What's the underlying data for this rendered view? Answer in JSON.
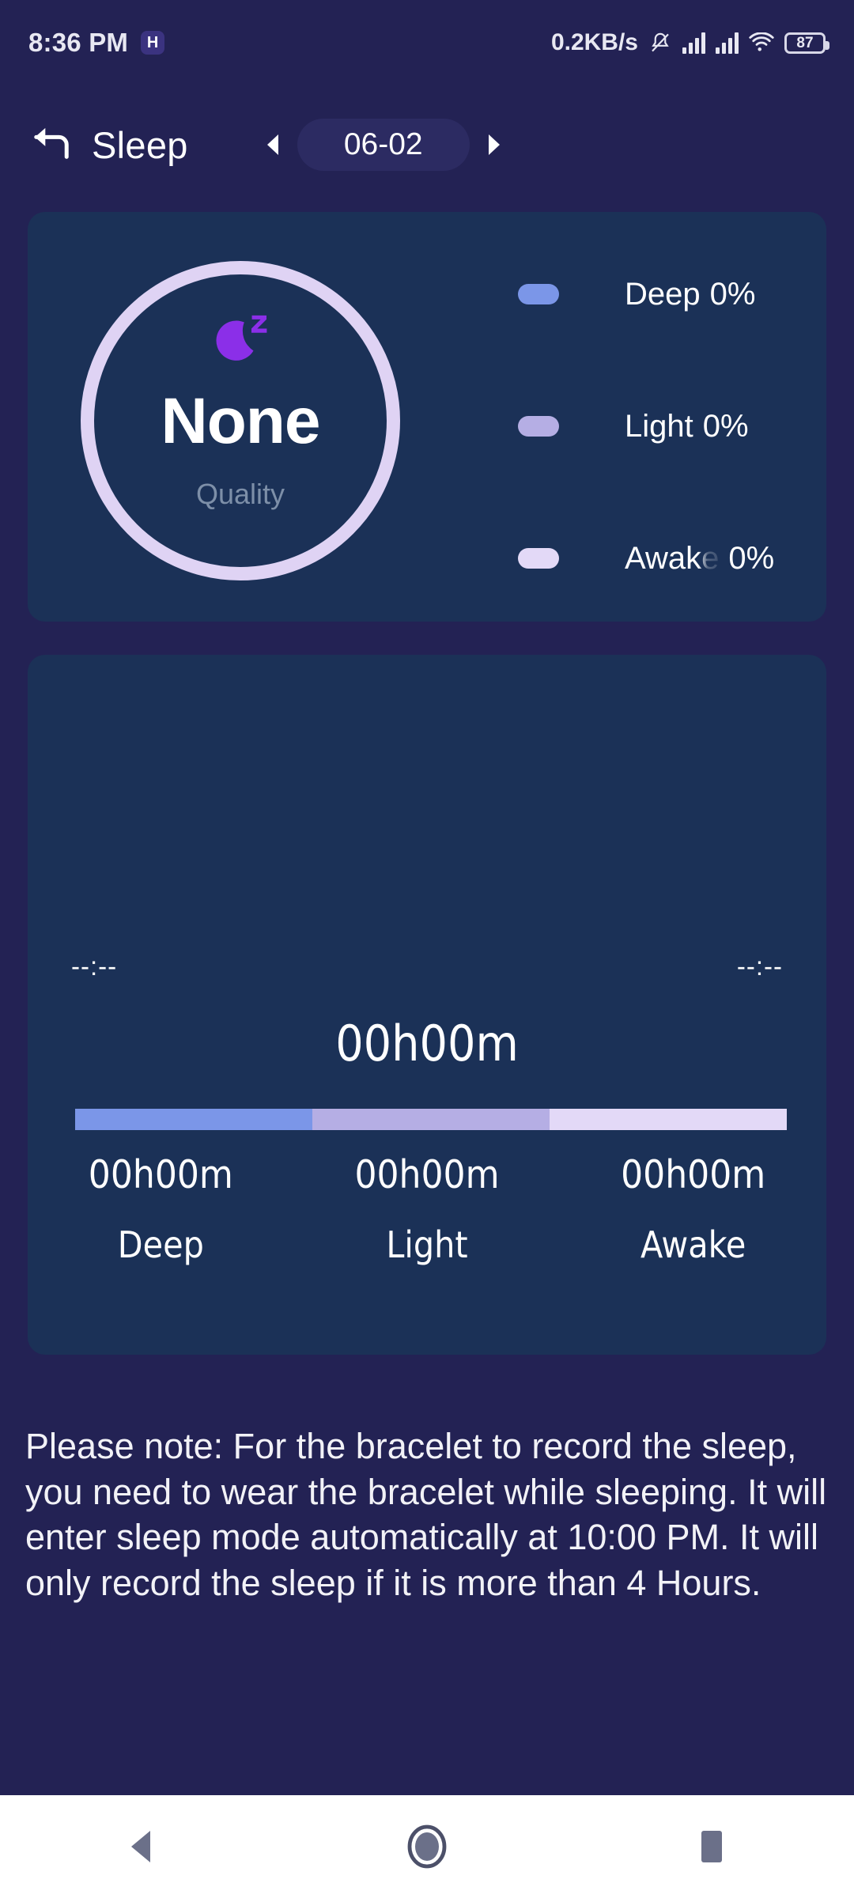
{
  "statusbar": {
    "time": "8:36 PM",
    "app_badge": "H",
    "network_speed": "0.2KB/s",
    "battery_level": "87",
    "icons": [
      "app-badge-icon",
      "notification-muted-icon",
      "signal-bars-sim1-icon",
      "signal-bars-sim2-icon",
      "wifi-icon",
      "battery-icon"
    ]
  },
  "header": {
    "back_icon": "back-arrow-icon",
    "title": "Sleep",
    "prev_icon": "chevron-left-icon",
    "date": "06-02",
    "next_icon": "chevron-right-icon"
  },
  "quality_card": {
    "moon_icon": "moon-sleep-icon",
    "value": "None",
    "label": "Quality",
    "ring_color": "#DFD3F4",
    "moon_color": "#8B2FE8",
    "legend": [
      {
        "name": "Deep",
        "percent": "0%",
        "color": "#7B96E8"
      },
      {
        "name": "Light",
        "percent": "0%",
        "color": "#B5AEE4"
      },
      {
        "name": "Awake",
        "percent": "0%",
        "color": "#E3D9F7"
      }
    ]
  },
  "detail_card": {
    "start_time": "--:--",
    "end_time": "--:--",
    "total": "00h00m",
    "stats": [
      {
        "value": "00h00m",
        "label": "Deep",
        "color": "#7B96E8"
      },
      {
        "value": "00h00m",
        "label": "Light",
        "color": "#B5AEE4"
      },
      {
        "value": "00h00m",
        "label": "Awake",
        "color": "#E3D9F7"
      }
    ]
  },
  "note": "Please note: For the bracelet to record the sleep, you need to wear the bracelet while sleeping. It will enter sleep mode automatically at 10:00 PM. It will only record the sleep if it is more than 4 Hours.",
  "navbar": {
    "back": "nav-back-icon",
    "home": "nav-home-icon",
    "recents": "nav-recents-icon"
  },
  "colors": {
    "page_bg": "#232254",
    "card_bg": "#1B3157",
    "accent_purple": "#8B2FE8",
    "ring": "#DFD3F4"
  }
}
